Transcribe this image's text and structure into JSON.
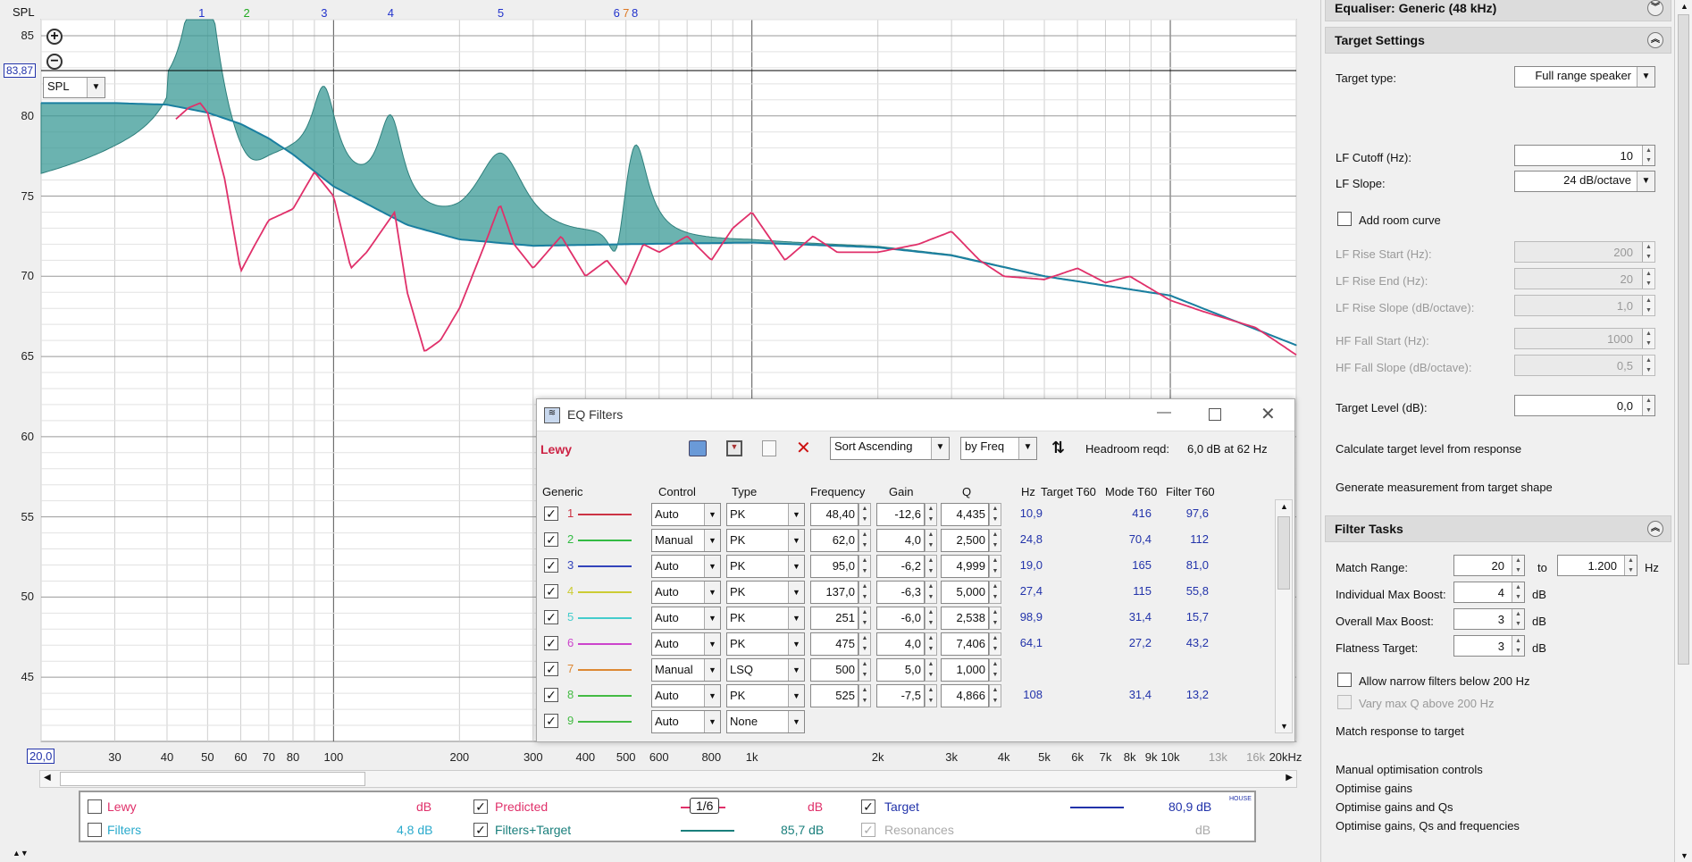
{
  "graph": {
    "y_axis_title": "SPL",
    "y_ticks": [
      "85",
      "80",
      "75",
      "70",
      "65",
      "60",
      "55",
      "50",
      "45"
    ],
    "y_readout": "83,87",
    "x_readout": "20,0",
    "x_ticks": [
      "30",
      "40",
      "50",
      "60",
      "70",
      "80",
      "100",
      "200",
      "300",
      "400",
      "500",
      "600",
      "800",
      "1k",
      "2k",
      "3k",
      "4k",
      "5k",
      "6k",
      "7k",
      "8k",
      "9k",
      "10k",
      "13k",
      "16k",
      "20kHz"
    ],
    "filter_markers": [
      {
        "label": "1",
        "color": "#2233cc"
      },
      {
        "label": "2",
        "color": "#22aa22"
      },
      {
        "label": "3",
        "color": "#2233cc"
      },
      {
        "label": "4",
        "color": "#2233cc"
      },
      {
        "label": "5",
        "color": "#2233cc"
      },
      {
        "label": "6",
        "color": "#2233cc"
      },
      {
        "label": "7",
        "color": "#dd7722"
      },
      {
        "label": "8",
        "color": "#2233cc"
      }
    ],
    "view_select": "SPL",
    "colors": {
      "predicted": "#e0306a",
      "target": "#1a7fa0",
      "fill": "#3a9a96"
    }
  },
  "chart_data": {
    "type": "line",
    "xlabel": "",
    "ylabel": "SPL",
    "x_scale": "log",
    "xlim": [
      20,
      20000
    ],
    "ylim": [
      41,
      86
    ],
    "series": [
      {
        "name": "Target",
        "x": [
          20,
          30,
          40,
          50,
          60,
          70,
          80,
          100,
          150,
          200,
          300,
          500,
          1000,
          2000,
          3000,
          5000,
          10000,
          20000
        ],
        "y": [
          80.8,
          80.8,
          80.7,
          80.2,
          79.5,
          78.6,
          77.6,
          75.6,
          73.2,
          72.3,
          71.9,
          72.0,
          72.1,
          71.8,
          71.3,
          70.0,
          68.8,
          65.7
        ]
      },
      {
        "name": "Predicted",
        "x": [
          42,
          45,
          48,
          50,
          55,
          60,
          65,
          70,
          80,
          90,
          100,
          110,
          120,
          140,
          150,
          165,
          180,
          200,
          230,
          250,
          270,
          300,
          350,
          400,
          450,
          500,
          550,
          600,
          700,
          800,
          900,
          1000,
          1200,
          1400,
          1600,
          2000,
          2500,
          3000,
          3500,
          4000,
          5000,
          6000,
          7000,
          8000,
          10000,
          12000,
          16000,
          20000
        ],
        "y": [
          79.8,
          80.5,
          80.8,
          80.2,
          76.0,
          70.3,
          72.0,
          73.5,
          74.2,
          76.5,
          75.0,
          70.5,
          71.5,
          74.0,
          69.0,
          65.3,
          66.0,
          68.0,
          72.0,
          74.5,
          72.0,
          70.5,
          72.5,
          70.0,
          71.0,
          69.5,
          72.0,
          71.5,
          72.5,
          71.0,
          73.0,
          74.0,
          71.0,
          72.5,
          71.5,
          71.5,
          72.0,
          72.8,
          71.0,
          70.0,
          69.8,
          70.5,
          69.6,
          70.0,
          68.5,
          67.8,
          66.8,
          65.1
        ]
      }
    ]
  },
  "legend": {
    "lewy": {
      "label": "Lewy",
      "value": "dB"
    },
    "predicted": {
      "label": "Predicted",
      "smoothing": "1/6",
      "value": "dB"
    },
    "target": {
      "label": "Target",
      "value": "80,9 dB",
      "sup": "HOUSE"
    },
    "filters": {
      "label": "Filters",
      "value": "4,8 dB"
    },
    "filters_target": {
      "label": "Filters+Target",
      "value": "85,7 dB"
    },
    "resonances": {
      "label": "Resonances",
      "value": "dB"
    }
  },
  "eq": {
    "title": "EQ Filters",
    "channel": "Lewy",
    "sort": "Sort Ascending",
    "by": "by Freq",
    "headroom_label": "Headroom reqd:",
    "headroom_value": "6,0 dB at 62 Hz",
    "headers": {
      "generic": "Generic",
      "control": "Control",
      "type": "Type",
      "frequency": "Frequency",
      "gain": "Gain",
      "q": "Q",
      "hz": "Hz",
      "target_t60": "Target T60",
      "mode_t60": "Mode T60",
      "filter_t60": "Filter T60"
    },
    "rows": [
      {
        "n": "1",
        "color": "#cc3344",
        "control": "Auto",
        "type": "PK",
        "freq": "48,40",
        "gain": "-12,6",
        "q": "4,435",
        "hz": "10,9",
        "mode": "416",
        "filt": "97,6"
      },
      {
        "n": "2",
        "color": "#33bb44",
        "control": "Manual",
        "type": "PK",
        "freq": "62,0",
        "gain": "4,0",
        "q": "2,500",
        "hz": "24,8",
        "mode": "70,4",
        "filt": "112"
      },
      {
        "n": "3",
        "color": "#3344bb",
        "control": "Auto",
        "type": "PK",
        "freq": "95,0",
        "gain": "-6,2",
        "q": "4,999",
        "hz": "19,0",
        "mode": "165",
        "filt": "81,0"
      },
      {
        "n": "4",
        "color": "#cccc33",
        "control": "Auto",
        "type": "PK",
        "freq": "137,0",
        "gain": "-6,3",
        "q": "5,000",
        "hz": "27,4",
        "mode": "115",
        "filt": "55,8"
      },
      {
        "n": "5",
        "color": "#44cccc",
        "control": "Auto",
        "type": "PK",
        "freq": "251",
        "gain": "-6,0",
        "q": "2,538",
        "hz": "98,9",
        "mode": "31,4",
        "filt": "15,7"
      },
      {
        "n": "6",
        "color": "#cc44cc",
        "control": "Auto",
        "type": "PK",
        "freq": "475",
        "gain": "4,0",
        "q": "7,406",
        "hz": "64,1",
        "mode": "27,2",
        "filt": "43,2"
      },
      {
        "n": "7",
        "color": "#dd8833",
        "control": "Manual",
        "type": "LSQ",
        "freq": "500",
        "gain": "5,0",
        "q": "1,000",
        "hz": "",
        "mode": "",
        "filt": ""
      },
      {
        "n": "8",
        "color": "#44bb44",
        "control": "Auto",
        "type": "PK",
        "freq": "525",
        "gain": "-7,5",
        "q": "4,866",
        "hz": "108",
        "mode": "31,4",
        "filt": "13,2"
      },
      {
        "n": "9",
        "color": "#44bb44",
        "control": "Auto",
        "type": "None",
        "freq": "",
        "gain": "",
        "q": "",
        "hz": "",
        "mode": "",
        "filt": ""
      }
    ]
  },
  "right": {
    "equaliser": "Equaliser: Generic (48 kHz)",
    "target_settings": "Target Settings",
    "target_type_label": "Target type:",
    "target_type": "Full range speaker",
    "lf_cutoff_label": "LF Cutoff (Hz):",
    "lf_cutoff": "10",
    "lf_slope_label": "LF Slope:",
    "lf_slope": "24 dB/octave",
    "add_room_curve": "Add room curve",
    "lf_rise_start_label": "LF Rise Start (Hz):",
    "lf_rise_start": "200",
    "lf_rise_end_label": "LF Rise End (Hz):",
    "lf_rise_end": "20",
    "lf_rise_slope_label": "LF Rise Slope (dB/octave):",
    "lf_rise_slope": "1,0",
    "hf_fall_start_label": "HF Fall Start (Hz):",
    "hf_fall_start": "1000",
    "hf_fall_slope_label": "HF Fall Slope (dB/octave):",
    "hf_fall_slope": "0,5",
    "target_level_label": "Target Level (dB):",
    "target_level": "0,0",
    "calc_target": "Calculate target level from response",
    "gen_measurement": "Generate measurement from target shape",
    "filter_tasks": "Filter Tasks",
    "match_range_label": "Match Range:",
    "match_from": "20",
    "to": "to",
    "match_to": "1.200",
    "hz": "Hz",
    "ind_boost_label": "Individual Max Boost:",
    "ind_boost": "4",
    "overall_boost_label": "Overall Max Boost:",
    "overall_boost": "3",
    "flatness_label": "Flatness Target:",
    "flatness": "3",
    "db": "dB",
    "allow_narrow": "Allow narrow filters below 200 Hz",
    "vary_q": "Vary max Q above 200 Hz",
    "match_response": "Match response to target",
    "manual_opt": "Manual optimisation controls",
    "opt_gains": "Optimise gains",
    "opt_gains_qs": "Optimise gains and Qs",
    "opt_all": "Optimise gains, Qs and frequencies"
  }
}
